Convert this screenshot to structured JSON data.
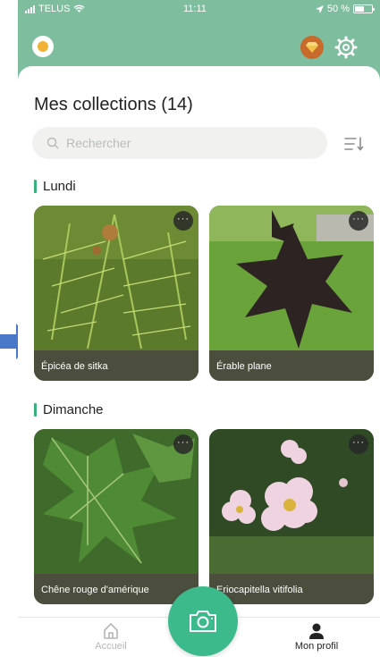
{
  "status_bar": {
    "carrier": "TELUS",
    "time": "11:11",
    "battery": "50 %"
  },
  "collections": {
    "title": "Mes collections (14)",
    "search_placeholder": "Rechercher"
  },
  "sections": [
    {
      "label": "Lundi",
      "cards": [
        {
          "name": "Épicéa de sitka"
        },
        {
          "name": "Érable plane"
        }
      ]
    },
    {
      "label": "Dimanche",
      "cards": [
        {
          "name": "Chêne rouge d'amérique"
        },
        {
          "name": "Eriocapitella vitifolia"
        }
      ]
    }
  ],
  "card_more": "···",
  "nav": {
    "home_label": "Accueil",
    "profile_label": "Mon profil"
  },
  "colors": {
    "header_bg": "#7fbd9f",
    "accent": "#3bb07f",
    "camera_button": "#3cba8c",
    "annotation_arrow": "#4a78c9"
  },
  "icons": [
    "signal-icon",
    "wifi-icon",
    "location-icon",
    "battery-icon",
    "app-logo-icon",
    "gem-icon",
    "gear-icon",
    "search-icon",
    "sort-icon",
    "more-icon",
    "home-icon",
    "camera-icon",
    "profile-icon",
    "arrow-icon"
  ]
}
